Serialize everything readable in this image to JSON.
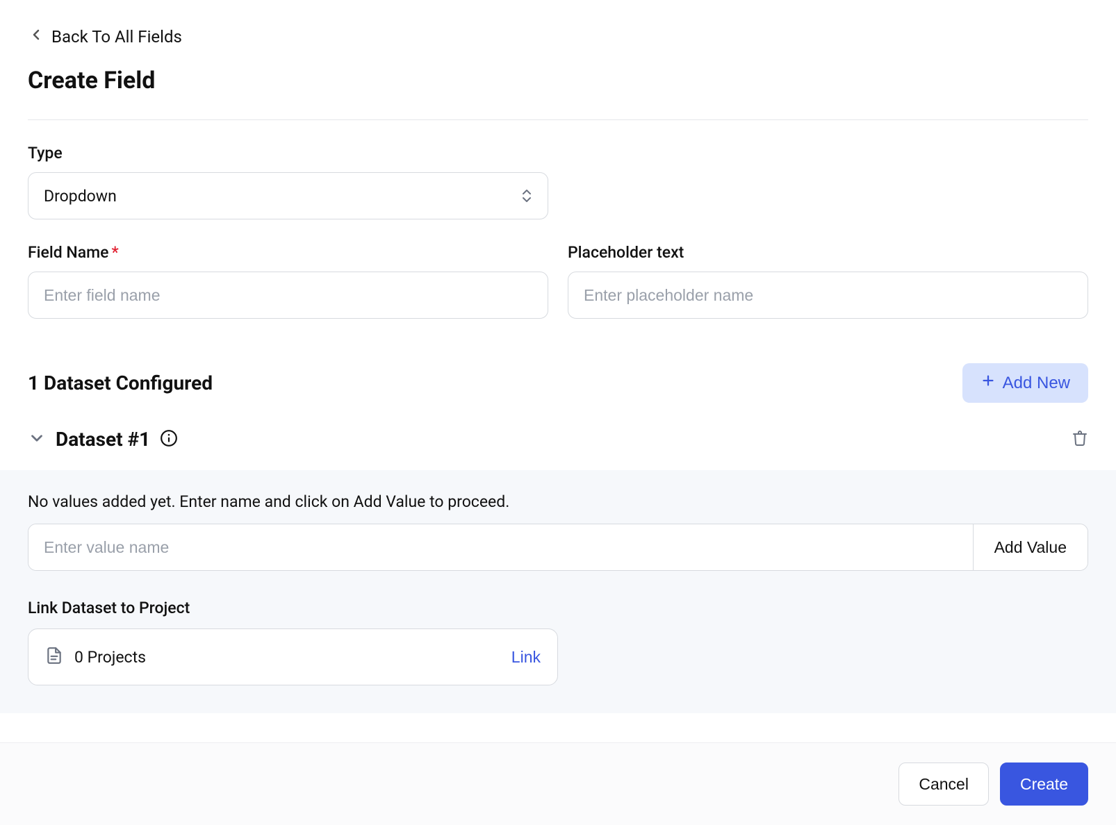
{
  "back_label": "Back To All Fields",
  "page_title": "Create Field",
  "type": {
    "label": "Type",
    "value": "Dropdown"
  },
  "field_name": {
    "label": "Field Name",
    "placeholder": "Enter field name",
    "value": ""
  },
  "placeholder_text": {
    "label": "Placeholder text",
    "placeholder": "Enter placeholder name",
    "value": ""
  },
  "dataset_heading": "1 Dataset Configured",
  "add_new_label": "Add New",
  "datasets": [
    {
      "title": "Dataset #1",
      "empty_message": "No values added yet. Enter name and click on Add Value to proceed.",
      "value_placeholder": "Enter value name",
      "add_value_label": "Add Value",
      "link_label": "Link Dataset to Project",
      "projects_count": "0 Projects",
      "link_btn_label": "Link"
    }
  ],
  "footer": {
    "cancel": "Cancel",
    "create": "Create"
  }
}
